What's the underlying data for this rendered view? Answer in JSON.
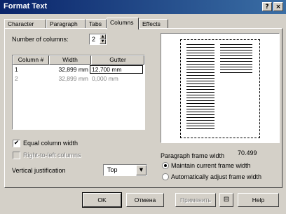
{
  "window": {
    "title": "Format Text",
    "help_btn": "?",
    "close_btn": "×"
  },
  "tabs": [
    {
      "label": "Character"
    },
    {
      "label": "Paragraph"
    },
    {
      "label": "Tabs"
    },
    {
      "label": "Columns"
    },
    {
      "label": "Effects"
    }
  ],
  "columns": {
    "number_label": "Number of columns:",
    "number_value": "2",
    "table_headers": [
      "Column #",
      "Width",
      "Gutter"
    ],
    "rows": [
      {
        "num": "1",
        "width": "32,899 mm",
        "gutter": "12,700 mm"
      },
      {
        "num": "2",
        "width": "32,899 mm",
        "gutter": "0,000 mm"
      }
    ],
    "equal_width_label": "Equal column width",
    "equal_width_checked": "✔",
    "rtl_label": "Right-to-left columns",
    "vertical_just_label": "Vertical justification",
    "vertical_just_value": "Top"
  },
  "frame": {
    "width_label": "Paragraph frame width",
    "width_value": "70.499",
    "option1": "Maintain current frame width",
    "option2": "Automatically adjust frame width"
  },
  "buttons": {
    "ok": "OK",
    "cancel": "Отмена",
    "apply": "Применить",
    "help": "Help"
  }
}
